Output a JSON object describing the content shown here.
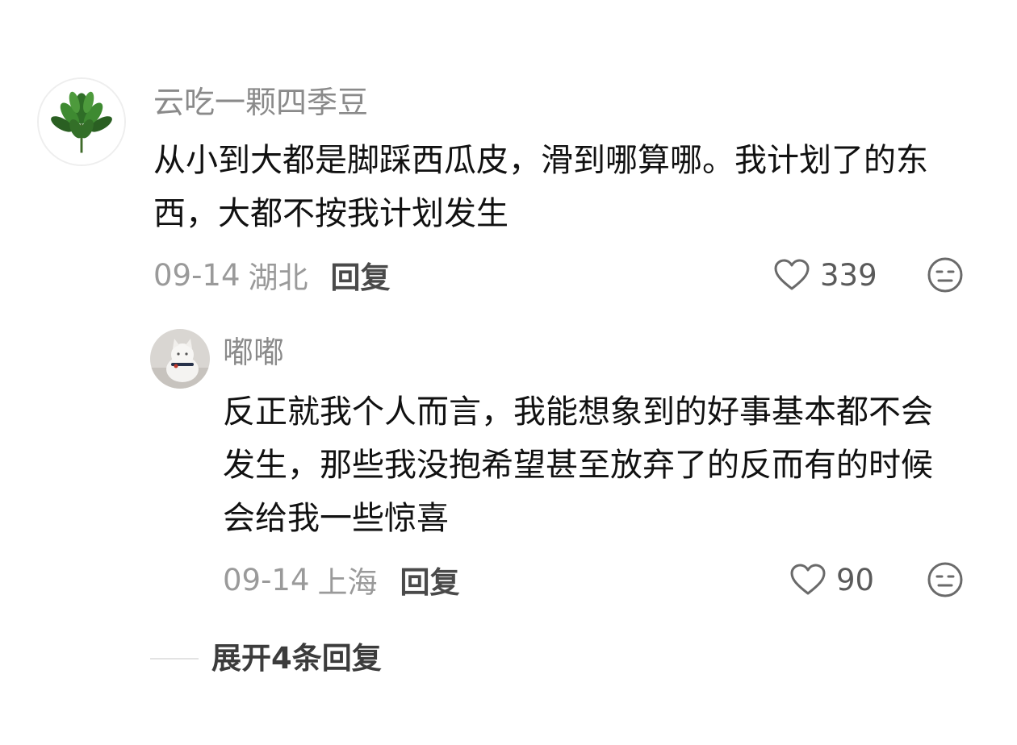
{
  "comments": [
    {
      "username": "云吃一颗四季豆",
      "avatar_icon": "plant-avatar-icon",
      "content_lines": [
        "从小到大都是脚踩西瓜皮，滑到哪算哪。我计划了的东",
        "西，大都不按我计划发生"
      ],
      "date": "09-14",
      "location": "湖北",
      "reply_label": "回复",
      "like_count": "339",
      "reaction_icon": "neutral-face-icon"
    },
    {
      "username": "嘟嘟",
      "avatar_icon": "cat-avatar-icon",
      "content_lines": [
        "反正就我个人而言，我能想象到的好事基本都不会",
        "发生，那些我没抱希望甚至放弃了的反而有的时候",
        "会给我一些惊喜"
      ],
      "date": "09-14",
      "location": "上海",
      "reply_label": "回复",
      "like_count": "90",
      "reaction_icon": "neutral-face-icon"
    }
  ],
  "expand_replies": "展开4条回复",
  "colors": {
    "username": "#8a8a8a",
    "meta": "#9a9a9a",
    "content": "#111111",
    "reply": "#4a4a4a"
  }
}
